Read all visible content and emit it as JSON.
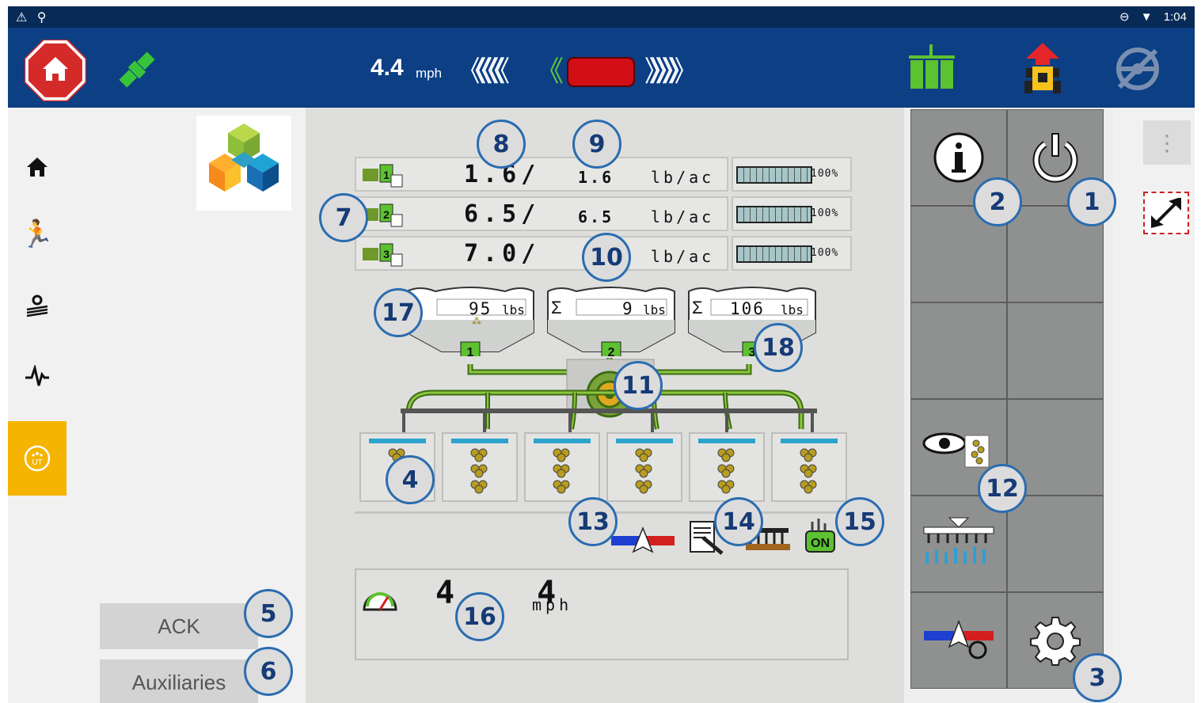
{
  "status_bar": {
    "time": "1:04"
  },
  "top_bar": {
    "speed_value": "4.4",
    "speed_unit": "mph",
    "guidance_left_chevrons": "《《《《《",
    "guidance_left_active": "《",
    "guidance_right_chevrons": "》》》》》"
  },
  "left_panel": {
    "ack_label": "ACK",
    "auxiliaries_label": "Auxiliaries"
  },
  "rates": [
    {
      "product": "1",
      "actual": "1.6/",
      "target": "1.6",
      "unit": "lb/ac",
      "percent": "100%"
    },
    {
      "product": "2",
      "actual": "6.5/",
      "target": "6.5",
      "unit": "lb/ac",
      "percent": "100%"
    },
    {
      "product": "3",
      "actual": "7.0/",
      "target": "",
      "unit": "lb/ac",
      "percent": "100%"
    }
  ],
  "tanks": [
    {
      "number": "1",
      "sigma": "",
      "value": "95",
      "unit": "lbs"
    },
    {
      "number": "2",
      "sigma": "Σ",
      "value": "9",
      "unit": "lbs"
    },
    {
      "number": "3",
      "sigma": "Σ",
      "value": "106",
      "unit": "lbs"
    }
  ],
  "row_units_count": 6,
  "speed_panel": {
    "value": "4 4",
    "unit": "mph"
  },
  "toolstrip": {
    "on_label": "ON"
  },
  "callouts": [
    "1",
    "2",
    "3",
    "4",
    "5",
    "6",
    "7",
    "8",
    "9",
    "10",
    "11",
    "12",
    "13",
    "14",
    "15",
    "16",
    "17",
    "18"
  ],
  "colors": {
    "top_bar": "#0c3f84",
    "status_bar": "#082a57",
    "accent_yellow": "#f5b400",
    "alert_red": "#d42a2a",
    "guidance_green": "#5fc23a",
    "implement_green": "#5a8a1e",
    "callout_border": "#2b6cb0"
  }
}
